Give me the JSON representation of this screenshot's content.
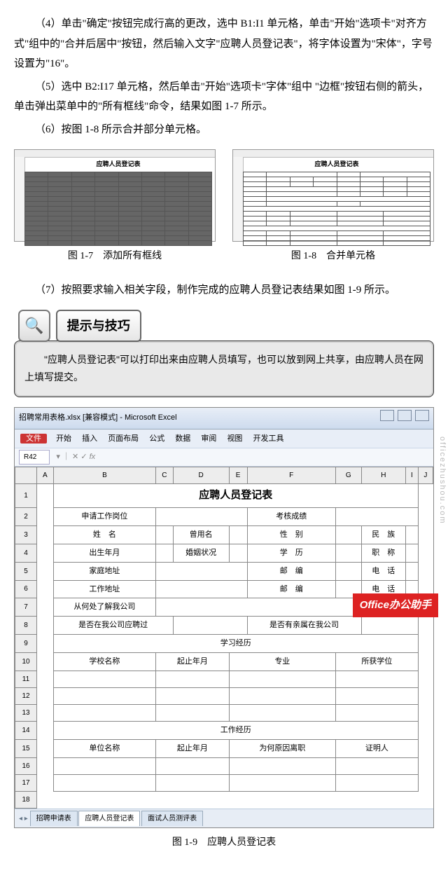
{
  "paragraphs": {
    "p4": "（4）单击\"确定\"按钮完成行高的更改，选中 B1:I1 单元格，单击\"开始\"选项卡\"对齐方式\"组中的\"合并后居中\"按钮，然后输入文字\"应聘人员登记表\"，将字体设置为\"宋体\"，字号设置为\"16\"。",
    "p5": "（5）选中 B2:I17 单元格，然后单击\"开始\"选项卡\"字体\"组中 \"边框\"按钮右侧的箭头，单击弹出菜单中的\"所有框线\"命令，结果如图 1-7 所示。",
    "p6": "（6）按图 1-8 所示合并部分单元格。",
    "p7": "（7）按照要求输入相关字段，制作完成的应聘人员登记表结果如图 1-9 所示。"
  },
  "figures": {
    "f17title": "应聘人员登记表",
    "f17cap": "图 1-7　添加所有框线",
    "f18title": "应聘人员登记表",
    "f18cap": "图 1-8　合并单元格",
    "f19cap": "图 1-9　应聘人员登记表"
  },
  "tip": {
    "label": "提示与技巧",
    "body": "\"应聘人员登记表\"可以打印出来由应聘人员填写，也可以放到网上共享，由应聘人员在网上填写提交。"
  },
  "excel": {
    "title": "招聘常用表格.xlsx [兼容模式] - Microsoft Excel",
    "menus": {
      "file": "文件",
      "m1": "开始",
      "m2": "插入",
      "m3": "页面布局",
      "m4": "公式",
      "m5": "数据",
      "m6": "审阅",
      "m7": "视图",
      "m8": "开发工具"
    },
    "namebox": "R42",
    "cols": [
      "",
      "A",
      "B",
      "C",
      "D",
      "E",
      "F",
      "G",
      "H",
      "I",
      "J"
    ],
    "rows_visible": [
      "1",
      "2",
      "3",
      "4",
      "5",
      "6",
      "7",
      "8",
      "9",
      "10",
      "11",
      "12",
      "13",
      "14",
      "15",
      "16",
      "17",
      "18"
    ],
    "form": {
      "title": "应聘人员登记表",
      "r2": {
        "a": "申请工作岗位",
        "b": "考核成绩"
      },
      "r3": {
        "a": "姓　名",
        "b": "曾用名",
        "c": "性　别",
        "d": "民　族"
      },
      "r4": {
        "a": "出生年月",
        "b": "婚姻状况",
        "c": "学　历",
        "d": "职　称"
      },
      "r5": {
        "a": "家庭地址",
        "b": "邮　编",
        "c": "电　话"
      },
      "r6": {
        "a": "工作地址",
        "b": "邮　编",
        "c": "电　话"
      },
      "r7": {
        "a": "从何处了解我公司"
      },
      "r8": {
        "a": "是否在我公司应聘过",
        "b": "是否有亲属在我公司"
      },
      "r9": "学习经历",
      "r10": {
        "a": "学校名称",
        "b": "起止年月",
        "c": "专业",
        "d": "所获学位"
      },
      "r14": "工作经历",
      "r15": {
        "a": "单位名称",
        "b": "起止年月",
        "c": "为何原因离职",
        "d": "证明人"
      }
    },
    "tabs": {
      "t1": "招聘申请表",
      "t2": "应聘人员登记表",
      "t3": "面试人员测评表"
    }
  },
  "watermark": "officezhushou.com",
  "brand": {
    "a": "Office",
    "b": "办公助手"
  }
}
